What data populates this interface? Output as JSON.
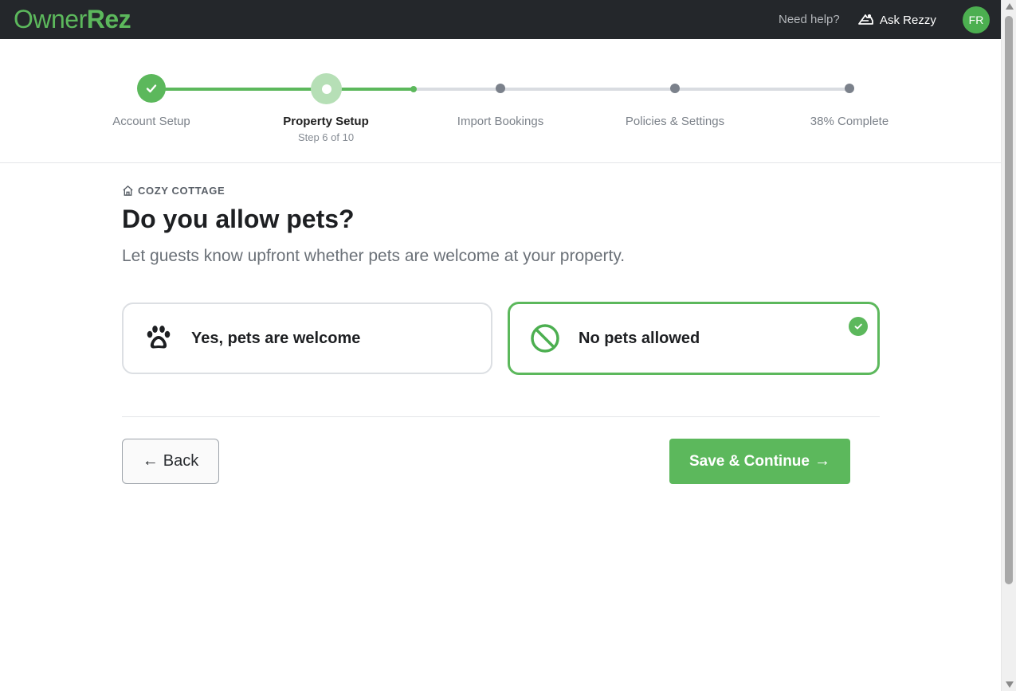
{
  "header": {
    "logo_part1": "Owner",
    "logo_part2": "Rez",
    "help_text": "Need help?",
    "ask_label": "Ask Rezzy",
    "avatar_initials": "FR"
  },
  "stepper": {
    "steps": [
      {
        "label": "Account Setup",
        "state": "complete"
      },
      {
        "label": "Property Setup",
        "state": "current",
        "sub": "Step 6 of 10"
      },
      {
        "label": "Import Bookings",
        "state": "upcoming"
      },
      {
        "label": "Policies & Settings",
        "state": "upcoming"
      },
      {
        "label": "38% Complete",
        "state": "upcoming"
      }
    ],
    "progress_fraction": 0.38
  },
  "main": {
    "property_name": "COZY COTTAGE",
    "title": "Do you allow pets?",
    "subtitle": "Let guests know upfront whether pets are welcome at your property.",
    "options": [
      {
        "label": "Yes, pets are welcome",
        "icon": "paw-icon",
        "selected": false
      },
      {
        "label": "No pets allowed",
        "icon": "no-entry-icon",
        "selected": true
      }
    ],
    "back_label": "Back",
    "save_label": "Save & Continue"
  },
  "colors": {
    "brand_green": "#5cb85c",
    "topbar": "#24272b",
    "muted_text": "#7c828a"
  }
}
